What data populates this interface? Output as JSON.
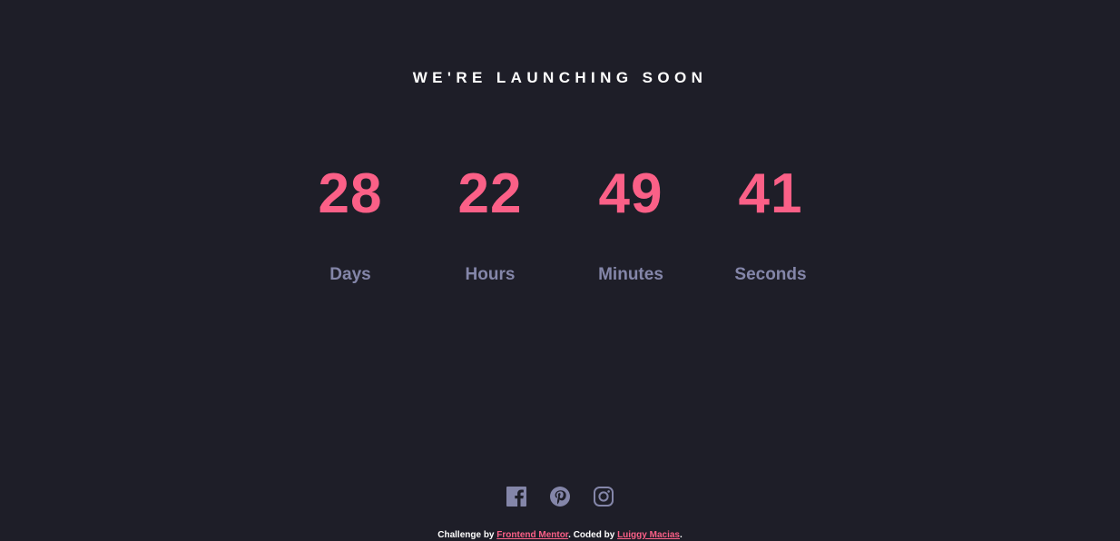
{
  "title": "WE'RE LAUNCHING SOON",
  "countdown": {
    "days": {
      "value": "28",
      "label": "Days"
    },
    "hours": {
      "value": "22",
      "label": "Hours"
    },
    "minutes": {
      "value": "49",
      "label": "Minutes"
    },
    "seconds": {
      "value": "41",
      "label": "Seconds"
    }
  },
  "social": {
    "icons": [
      "facebook-icon",
      "pinterest-icon",
      "instagram-icon"
    ],
    "icon_color": "#8486a9"
  },
  "attribution": {
    "prefix": "Challenge by ",
    "link1": "Frontend Mentor",
    "middle": ". Coded by ",
    "link2": "Luiggy Macias",
    "suffix": "."
  },
  "colors": {
    "background": "#1e1e28",
    "accent": "#fb6087",
    "label": "#8486a9",
    "text": "#ffffff"
  }
}
